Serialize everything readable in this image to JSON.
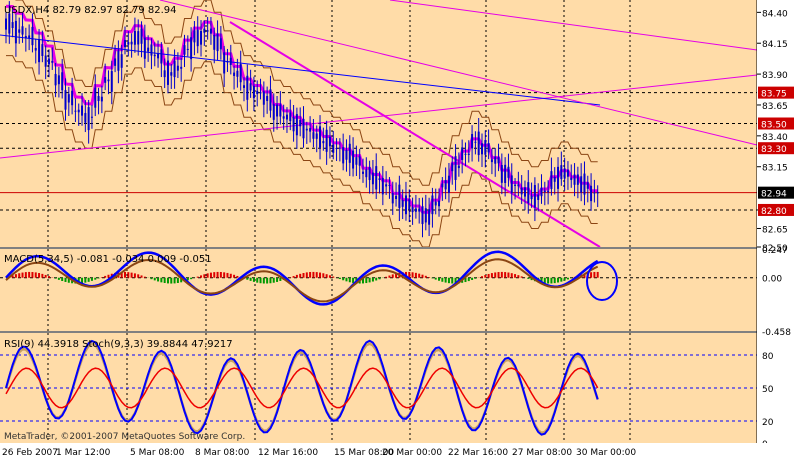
{
  "chart_data": [
    {
      "type": "candlestick",
      "title": "USDX,H4  82.79 82.97 82.79 82.94",
      "yticks": [
        "84.40",
        "84.15",
        "83.90",
        "83.65",
        "83.40",
        "83.15",
        "82.80",
        "82.65",
        "82.50"
      ],
      "ylim": [
        82.5,
        84.5
      ],
      "xticks": [
        "26 Feb 2007",
        "1 Mar 12:00",
        "5 Mar 08:00",
        "8 Mar 08:00",
        "12 Mar 16:00",
        "15 Mar 08:00",
        "20 Mar 00:00",
        "22 Mar 16:00",
        "27 Mar 08:00",
        "30 Mar 00:00"
      ],
      "price_labels": [
        {
          "value": 83.75,
          "color": "#cc0000"
        },
        {
          "value": 83.5,
          "color": "#cc0000"
        },
        {
          "value": 83.3,
          "color": "#cc0000"
        },
        {
          "value": 82.94,
          "color": "#000000"
        },
        {
          "value": 82.8,
          "color": "#cc0000"
        }
      ],
      "series": [
        {
          "close": [
            84.3,
            84.25,
            84.2,
            84.1,
            84.0,
            83.85,
            83.7,
            83.6,
            83.55,
            83.7,
            83.85,
            84.0,
            84.15,
            84.2,
            84.1,
            84.05,
            83.9,
            83.95,
            84.1,
            84.2,
            84.25,
            84.15,
            84.0,
            83.9,
            83.8,
            83.75,
            83.7,
            83.6,
            83.55,
            83.5,
            83.45,
            83.4,
            83.35,
            83.3,
            83.25,
            83.2,
            83.1,
            83.05,
            83.0,
            82.9,
            82.85,
            82.8,
            82.75,
            82.85,
            83.0,
            83.15,
            83.25,
            83.35,
            83.3,
            83.2,
            83.1,
            83.0,
            82.95,
            82.9,
            82.95,
            83.05,
            83.1,
            83.05,
            83.0,
            82.94
          ]
        }
      ]
    },
    {
      "type": "line",
      "title": "MACD(5,34,5) -0.081 -0.034 0.009 -0.051",
      "yticks": [
        "0.247",
        "0.00",
        "-0.458"
      ],
      "ylim": [
        -0.458,
        0.247
      ]
    },
    {
      "type": "line",
      "title": "RSI(9) 44.3918  Stoch(9,3,3) 39.8844 47.9217",
      "yticks": [
        "80",
        "50",
        "20",
        "0"
      ],
      "ylim": [
        0,
        100
      ]
    }
  ],
  "copyright": "MetaTrader, ©2001-2007 MetaQuotes Software Corp.",
  "colors": {
    "background": "#ffdca8",
    "sar": "#006600",
    "main_trend": "#e600e6",
    "channel": "#8b4513"
  }
}
